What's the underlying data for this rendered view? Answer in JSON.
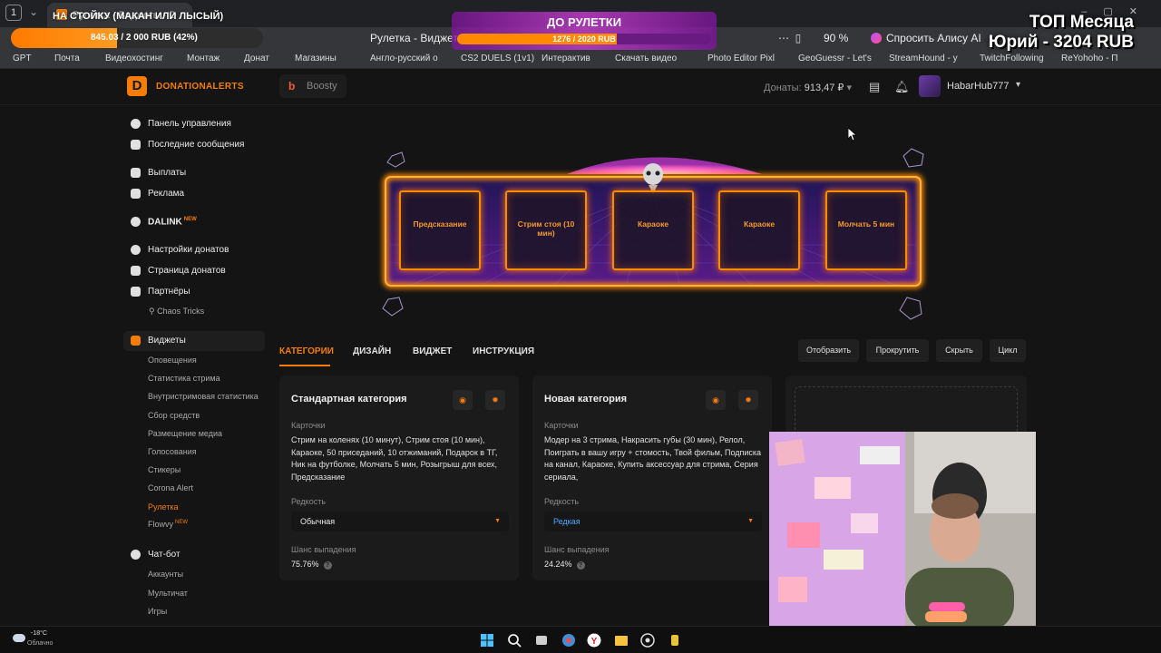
{
  "browser": {
    "tab_count": "1",
    "tab_title": "Рулетка - Виджеты - D",
    "url_text": "Рулетка - Виджеты",
    "zoom": "90 %",
    "alice_label": "Спросить Алису AI"
  },
  "bookmarks": [
    "GPT",
    "Почта",
    "Видеохостинг",
    "Монтаж",
    "Донат",
    "Магазины",
    "Англо-русский о",
    "CS2 DUELS (1v1)",
    "Интерактив",
    "Скачать видео",
    "Photo Editor Pixl",
    "GeoGuessr - Let's",
    "StreamHound - y",
    "TwitchFollowing",
    "ReYohoho - П"
  ],
  "overlay": {
    "stream_title": "НА СТОЙКУ (МАКАН ИЛИ ЛЫСЫЙ)",
    "goal_text": "845.03 / 2 000 RUB (42%)",
    "goal_percent": 42,
    "roulette_title": "ДО РУЛЕТКИ",
    "roulette_progress": "1276 / 2020 RUB",
    "roulette_percent": 63,
    "top_month_line1": "ТОП Месяца",
    "top_month_line2": "Юрий - 3204 RUB"
  },
  "header": {
    "logo_text": "DONATIONALERTS",
    "boosty_label": "Boosty",
    "donates_label": "Донаты:",
    "donates_value": "913,47 ₽",
    "username": "HabarHub777"
  },
  "sidebar": {
    "items": [
      {
        "label": "Панель управления"
      },
      {
        "label": "Последние сообщения"
      },
      {
        "label": "Выплаты"
      },
      {
        "label": "Реклама"
      },
      {
        "label": "DALINK"
      },
      {
        "label": "Настройки донатов"
      },
      {
        "label": "Страница донатов"
      },
      {
        "label": "Партнёры"
      },
      {
        "label": "Виджеты"
      },
      {
        "label": "Чат-бот"
      }
    ],
    "new_badge": "NEW",
    "partners_sub": [
      "Chaos Tricks"
    ],
    "widgets_sub": [
      "Оповещения",
      "Статистика стрима",
      "Внутристримовая статистика",
      "Сбор средств",
      "Размещение медиа",
      "Голосования",
      "Стикеры",
      "Corona Alert",
      "Рулетка",
      "Flowvy"
    ],
    "chatbot_sub": [
      "Аккаунты",
      "Мультичат",
      "Игры"
    ]
  },
  "roulette": {
    "slots": [
      "Предсказание",
      "Стрим стоя (10 мин)",
      "Караоке",
      "Караоке",
      "Молчать 5 мин"
    ]
  },
  "tabs": [
    "КАТЕГОРИИ",
    "ДИЗАЙН",
    "ВИДЖЕТ",
    "ИНСТРУКЦИЯ"
  ],
  "actions": [
    "Отобразить",
    "Прокрутить",
    "Скрыть",
    "Цикл"
  ],
  "cards": [
    {
      "title": "Стандартная категория",
      "cards_label": "Карточки",
      "cards_text": "Стрим на коленях (10 минут), Стрим стоя (10 мин), Караоке, 50 приседаний, 10 отжиманий, Подарок в ТГ, Ник на футболке, Молчать 5 мин, Розыгрыш для всех, Предсказание",
      "rarity_label": "Редкость",
      "rarity_value": "Обычная",
      "chance_label": "Шанс выпадения",
      "chance_value": "75.76%"
    },
    {
      "title": "Новая категория",
      "cards_label": "Карточки",
      "cards_text": "Модер на 3 стрима, Накрасить губы (30 мин), Релол, Поиграть в вашу игру + стомость, Твой фильм, Подписка на канал, Караоке, Купить аксессуар для стрима, Серия сериала,",
      "rarity_label": "Редкость",
      "rarity_value": "Редкая",
      "chance_label": "Шанс выпадения",
      "chance_value": "24.24%"
    }
  ],
  "taskbar": {
    "temperature": "-18°C",
    "weather": "Облачно"
  },
  "colors": {
    "accent": "#f57d07",
    "rare": "#4aa8ff",
    "background": "#141414",
    "card": "#1b1b1b"
  }
}
